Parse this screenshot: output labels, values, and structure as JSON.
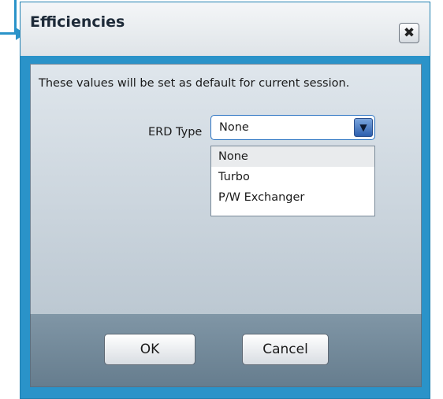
{
  "dialog": {
    "title": "Efficiencies",
    "close_glyph": "✖",
    "close_icon": "close-icon",
    "info_text": "These values will be set as default for current session.",
    "erd_label": "ERD Type",
    "erd_selected": "None",
    "dropdown_arrow_glyph": "▼",
    "erd_options": [
      "None",
      "Turbo",
      "P/W Exchanger"
    ],
    "ok_label": "OK",
    "cancel_label": "Cancel"
  },
  "colors": {
    "accent": "#2a93c9",
    "select_border": "#2b73c2",
    "highlight": "#e9ebed"
  }
}
